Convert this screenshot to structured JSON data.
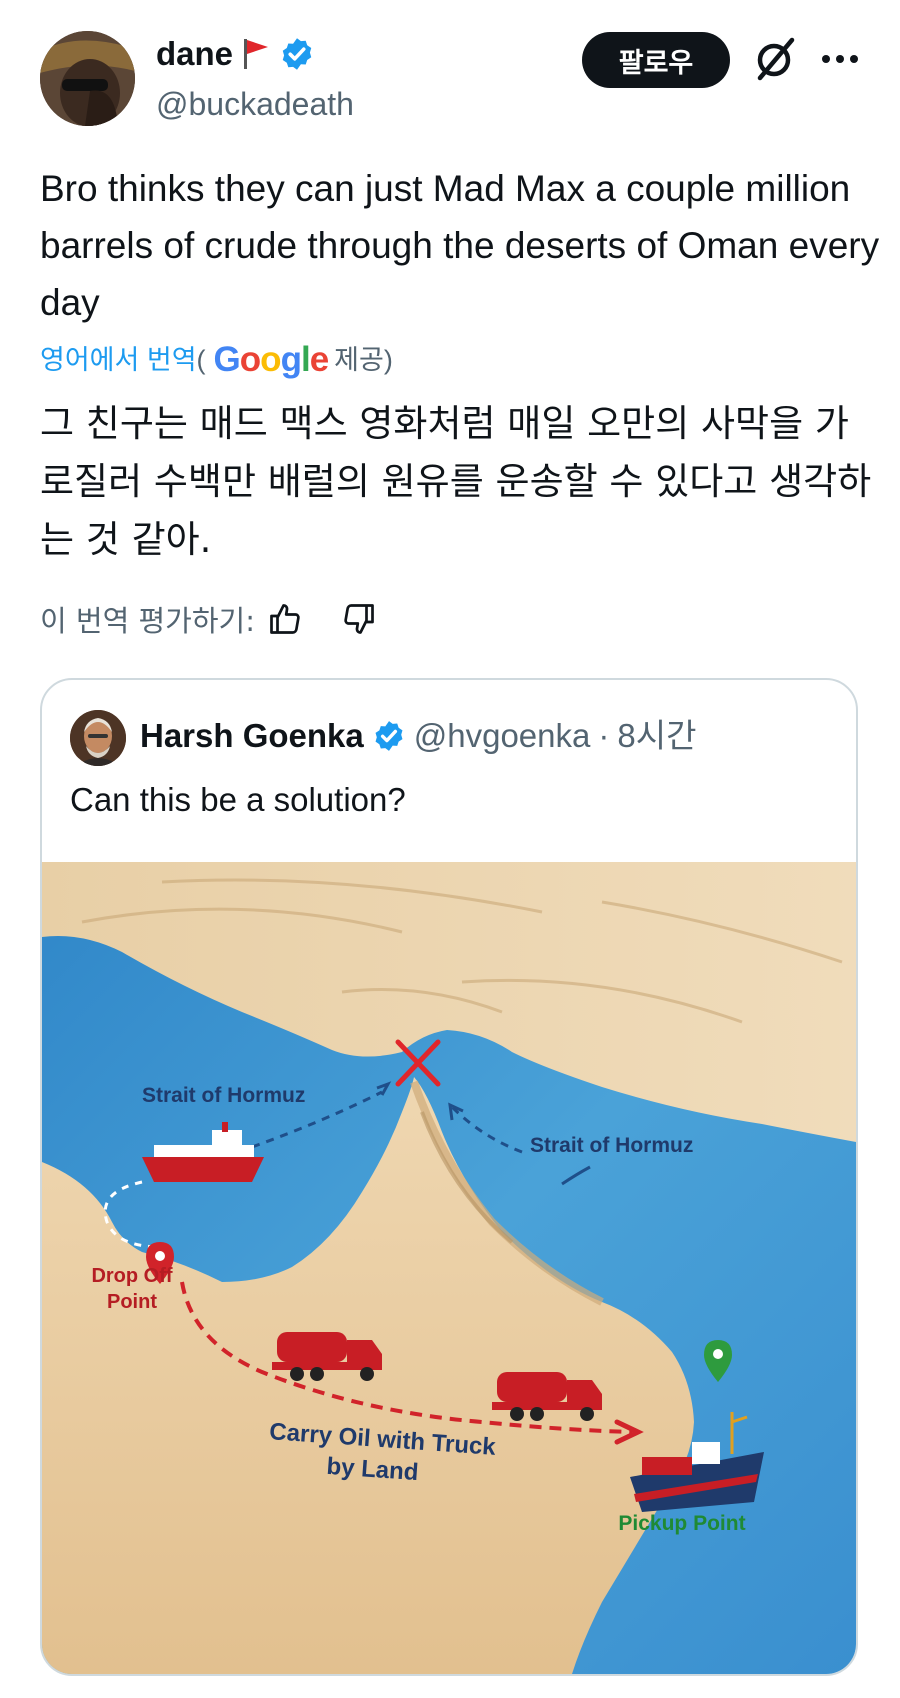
{
  "author": {
    "name": "dane",
    "handle": "@buckadeath"
  },
  "header": {
    "follow_label": "팔로우"
  },
  "icons": {
    "flag": "red-flag-icon",
    "verified": "verified-badge-icon",
    "grok": "grok-icon",
    "more": "more-icon",
    "thumb_up": "thumbs-up-icon",
    "thumb_down": "thumbs-down-icon"
  },
  "tweet": {
    "text": "Bro thinks they can just Mad Max a couple million barrels of crude through the deserts of Oman every day",
    "translation_link": "영어에서 번역",
    "translation_open": "(",
    "translation_provider": "Google",
    "translation_provided": "제공)",
    "translated_text": "그 친구는 매드 맥스 영화처럼 매일 오만의 사막을 가로질러 수백만 배럴의 원유를 운송할 수 있다고 생각하는 것 같아.",
    "rate_label": "이 번역 평가하기:"
  },
  "quote": {
    "name": "Harsh Goenka",
    "handle": "@hvgoenka",
    "separator": "·",
    "time": "8시간",
    "text": "Can this be a solution?"
  },
  "map": {
    "label_strait_left": "Strait of Hormuz",
    "label_strait_right": "Strait of Hormuz",
    "label_dropoff_line1": "Drop Off",
    "label_dropoff_line2": "Point",
    "label_carry_line1": "Carry Oil with Truck",
    "label_carry_line2": "by Land",
    "label_pickup": "Pickup Point"
  },
  "colors": {
    "accent": "#1d9bf0",
    "text": "#0f1419",
    "secondary": "#536471",
    "route_red": "#d1232a",
    "pin_green": "#2e9b3e",
    "sea": "#3a8fcf",
    "sand": "#e7c89a"
  }
}
